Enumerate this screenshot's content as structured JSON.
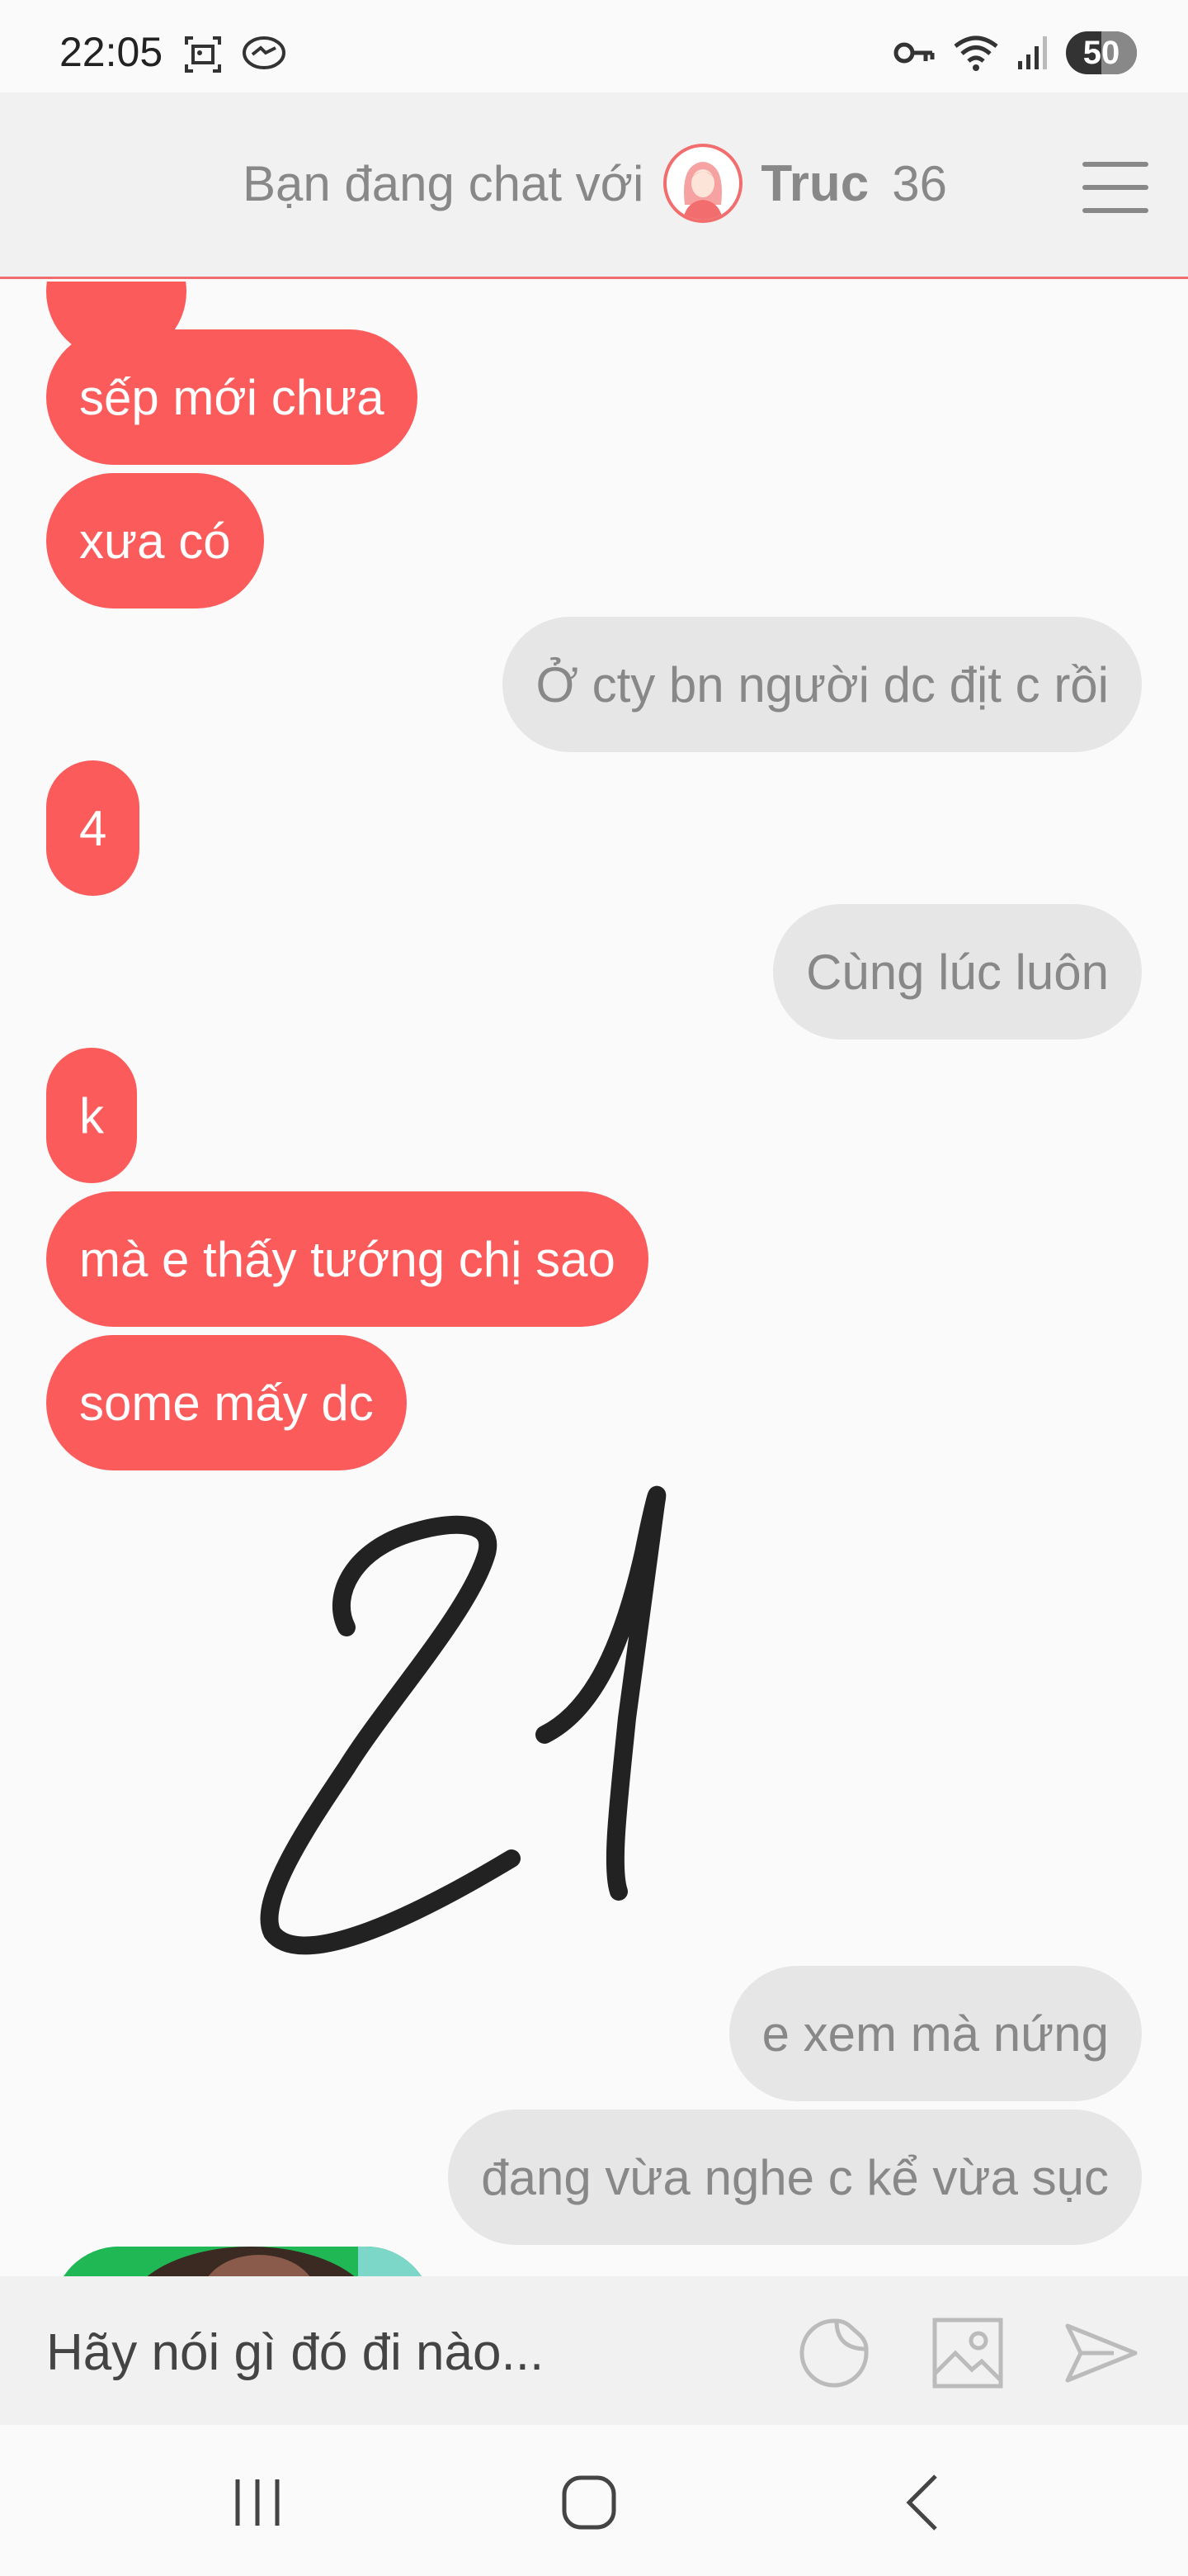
{
  "status_bar": {
    "time": "22:05",
    "battery": "50",
    "battery_level": 0.5,
    "icons": [
      "screenshot-icon",
      "messenger-icon",
      "key-icon",
      "wifi-icon",
      "signal-icon"
    ]
  },
  "header": {
    "prefix": "Bạn đang chat với",
    "name": "Truc",
    "age": "36",
    "accent_color": "#f26d6d"
  },
  "messages": [
    {
      "side": "received",
      "text": ""
    },
    {
      "side": "received",
      "text": "sếp mới chưa"
    },
    {
      "side": "received",
      "text": "xưa có"
    },
    {
      "side": "sent",
      "text": "Ở cty bn người dc địt c rồi"
    },
    {
      "side": "received",
      "text": "4"
    },
    {
      "side": "sent",
      "text": "Cùng lúc luôn"
    },
    {
      "side": "received",
      "text": "k"
    },
    {
      "side": "received",
      "text": "mà e thấy tướng chị sao"
    },
    {
      "side": "received",
      "text": "some mấy dc"
    },
    {
      "side": "sent",
      "text": "e xem mà nứng"
    },
    {
      "side": "sent",
      "text": "đang vừa nghe c kể vừa sục"
    }
  ],
  "handwriting_number": "21",
  "input": {
    "placeholder": "Hãy nói gì đó đi nào...",
    "icons": [
      "sticker-icon",
      "image-icon",
      "send-icon"
    ]
  },
  "colors": {
    "received_bubble": "#fb5b5b",
    "sent_bubble": "#e6e6e6",
    "icon_gray": "#bbbbbb"
  },
  "nav": {
    "buttons": [
      "recent-apps-icon",
      "home-icon",
      "back-icon"
    ]
  }
}
